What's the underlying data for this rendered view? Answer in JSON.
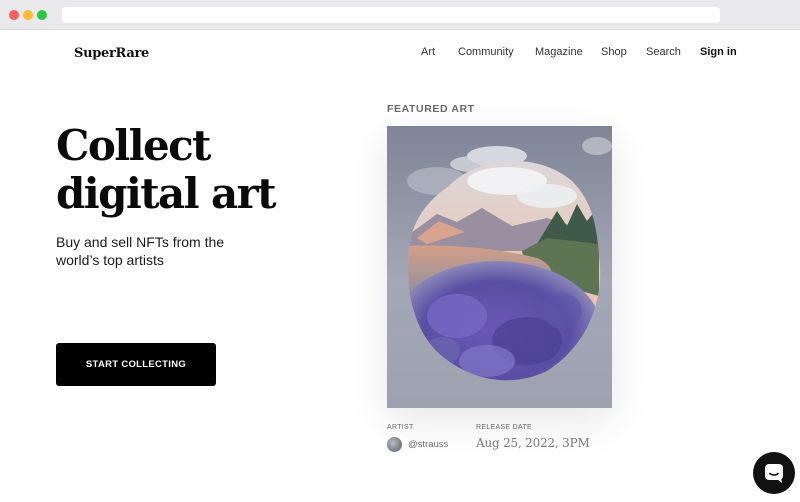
{
  "header": {
    "logo": "SuperRare",
    "nav": [
      "Art",
      "Community",
      "Magazine",
      "Shop",
      "Search"
    ],
    "sign_in": "Sign in"
  },
  "hero": {
    "title_line1": "Collect",
    "title_line2": "digital art",
    "subtitle": "Buy and sell NFTs from the world’s top artists",
    "cta": "START COLLECTING"
  },
  "featured": {
    "label": "FEATURED ART",
    "artist_label": "ARTIST",
    "artist": "@strauss",
    "release_label": "RELEASE DATE",
    "release_date": "Aug 25, 2022, 3PM"
  },
  "icons": {
    "chat": "chat-bubble-icon",
    "avatar": "artist-avatar"
  },
  "colors": {
    "cta_background": "#000000",
    "nav_text": "#333333",
    "muted_text": "#6b6b6b"
  }
}
